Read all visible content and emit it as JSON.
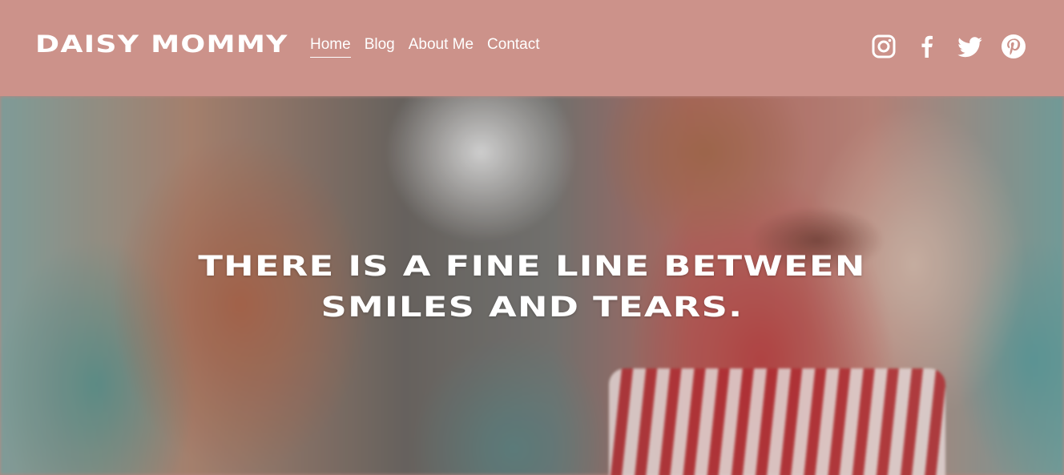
{
  "site": {
    "brand": "DAISY MOMMY"
  },
  "nav": {
    "items": [
      {
        "label": "Home",
        "active": true
      },
      {
        "label": "Blog",
        "active": false
      },
      {
        "label": "About Me",
        "active": false
      },
      {
        "label": "Contact",
        "active": false
      }
    ]
  },
  "socials": [
    {
      "name": "instagram-icon"
    },
    {
      "name": "facebook-icon"
    },
    {
      "name": "twitter-icon"
    },
    {
      "name": "pinterest-icon"
    }
  ],
  "hero": {
    "headline_line1": "THERE IS A FINE LINE BETWEEN",
    "headline_line2": "SMILES AND TEARS."
  },
  "colors": {
    "header_bg": "#cc928a",
    "text": "#ffffff"
  }
}
